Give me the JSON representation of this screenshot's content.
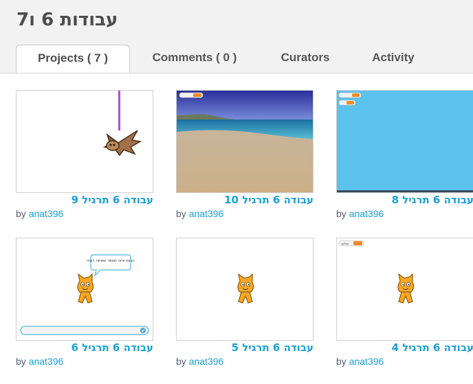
{
  "gallery": {
    "title": "עבודות 6 ו7"
  },
  "tabs": [
    {
      "label": "Projects ( 7 )"
    },
    {
      "label": "Comments ( 0 )"
    },
    {
      "label": "Curators"
    },
    {
      "label": "Activity"
    }
  ],
  "byline_prefix": "by",
  "projects": [
    {
      "title": "עבודה 6 תרגיל 9",
      "author": "anat396"
    },
    {
      "title": "עבודה 6 תרגיל 10",
      "author": "anat396"
    },
    {
      "title": "עבודה 6 תרגיל 8",
      "author": "anat396"
    },
    {
      "title": "עבודה 6 תרגיל 6",
      "author": "anat396"
    },
    {
      "title": "עבודה 6 תרגיל 5",
      "author": "anat396"
    },
    {
      "title": "עבודה 6 תרגיל 4",
      "author": "anat396"
    }
  ],
  "thumbnails": {
    "speech_bubble": "הכנס איזה מספר שאתה רוצה",
    "var_label": "שלום"
  }
}
